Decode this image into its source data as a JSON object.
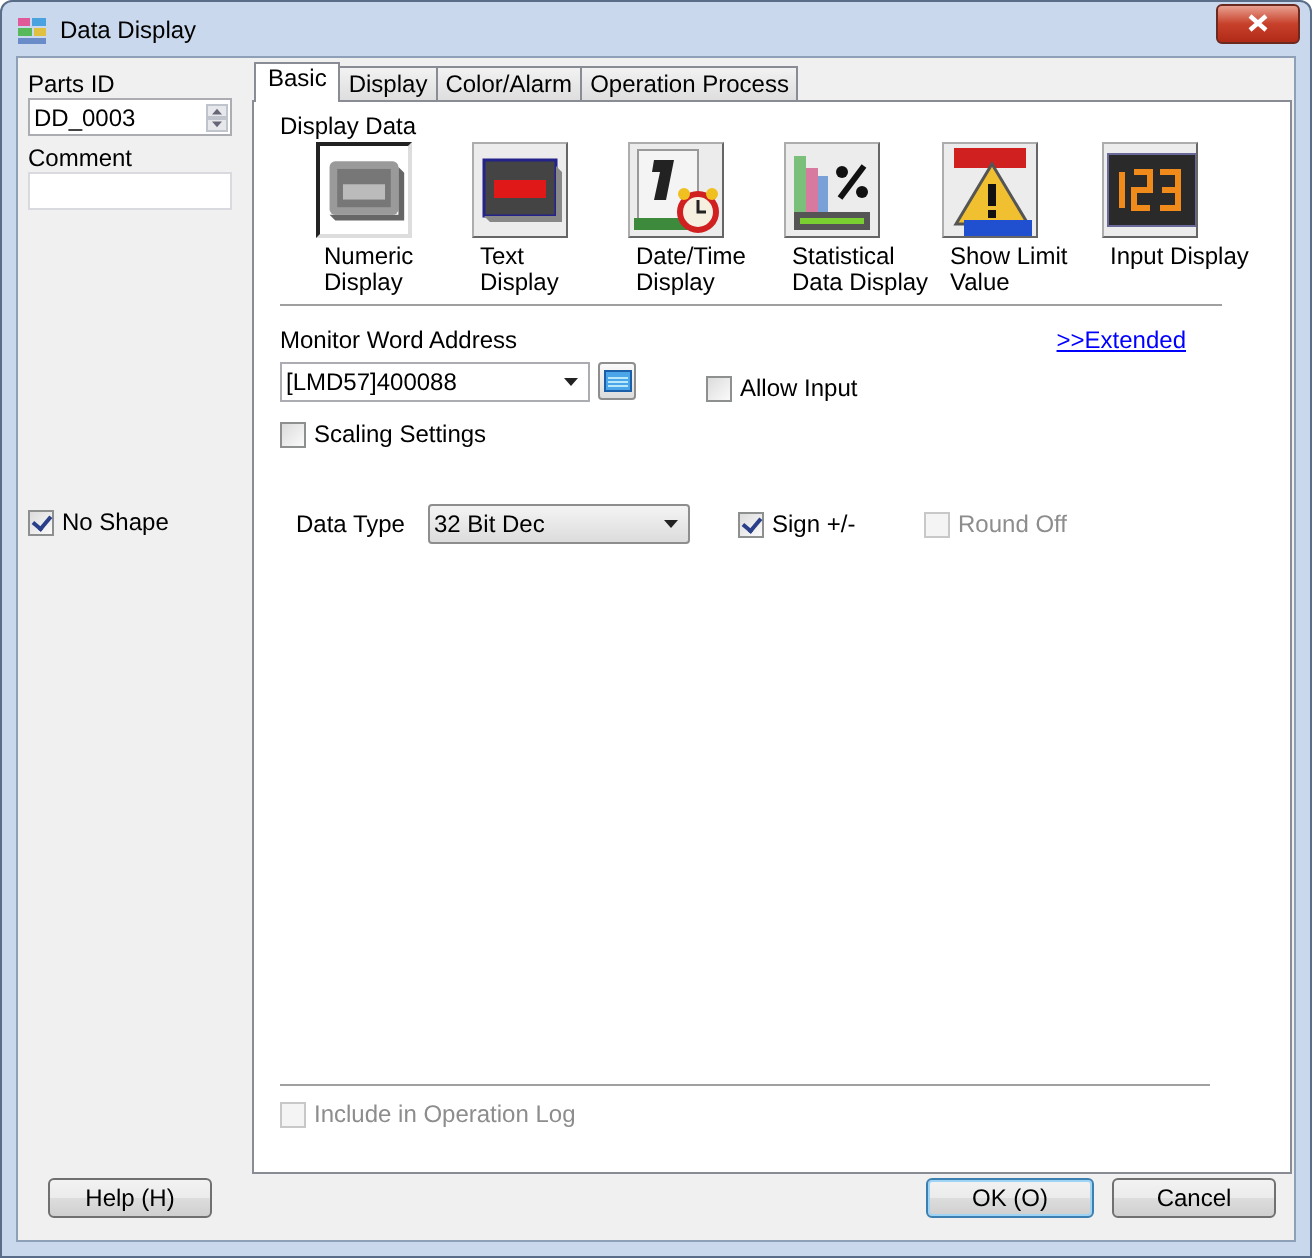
{
  "window": {
    "title": "Data Display"
  },
  "left": {
    "parts_id_label": "Parts ID",
    "parts_id": "DD_0003",
    "comment_label": "Comment",
    "no_shape": {
      "label": "No Shape",
      "checked": true,
      "disabled": false
    }
  },
  "tabs": [
    {
      "label": "Basic",
      "selected": true
    },
    {
      "label": "Display",
      "selected": false
    },
    {
      "label": "Color/Alarm",
      "selected": false
    },
    {
      "label": "Operation Process",
      "selected": false
    }
  ],
  "display_data": {
    "title": "Display Data",
    "items": [
      {
        "kind": "numeric",
        "label": "Numeric\nDisplay",
        "selected": true
      },
      {
        "kind": "text",
        "label": "Text\nDisplay",
        "selected": false
      },
      {
        "kind": "datetime",
        "label": "Date/Time\nDisplay",
        "selected": false
      },
      {
        "kind": "statistical",
        "label": "Statistical\nData Display",
        "selected": false
      },
      {
        "kind": "limit",
        "label": "Show Limit\nValue",
        "selected": false
      },
      {
        "kind": "input",
        "label": "Input Display",
        "selected": false
      }
    ]
  },
  "monitor": {
    "label": "Monitor Word Address",
    "value": "[LMD57]400088",
    "extended_link": ">>Extended"
  },
  "allow_input": {
    "label": "Allow Input",
    "checked": false,
    "disabled": false
  },
  "scaling": {
    "label": "Scaling Settings",
    "checked": false,
    "disabled": false
  },
  "data_type": {
    "label": "Data Type",
    "value": "32 Bit Dec"
  },
  "sign": {
    "label": "Sign +/-",
    "checked": true,
    "disabled": false
  },
  "round_off": {
    "label": "Round Off",
    "checked": false,
    "disabled": true
  },
  "operation_log": {
    "label": "Include in Operation Log",
    "checked": false,
    "disabled": true
  },
  "buttons": {
    "help": "Help (H)",
    "ok": "OK (O)",
    "cancel": "Cancel"
  }
}
